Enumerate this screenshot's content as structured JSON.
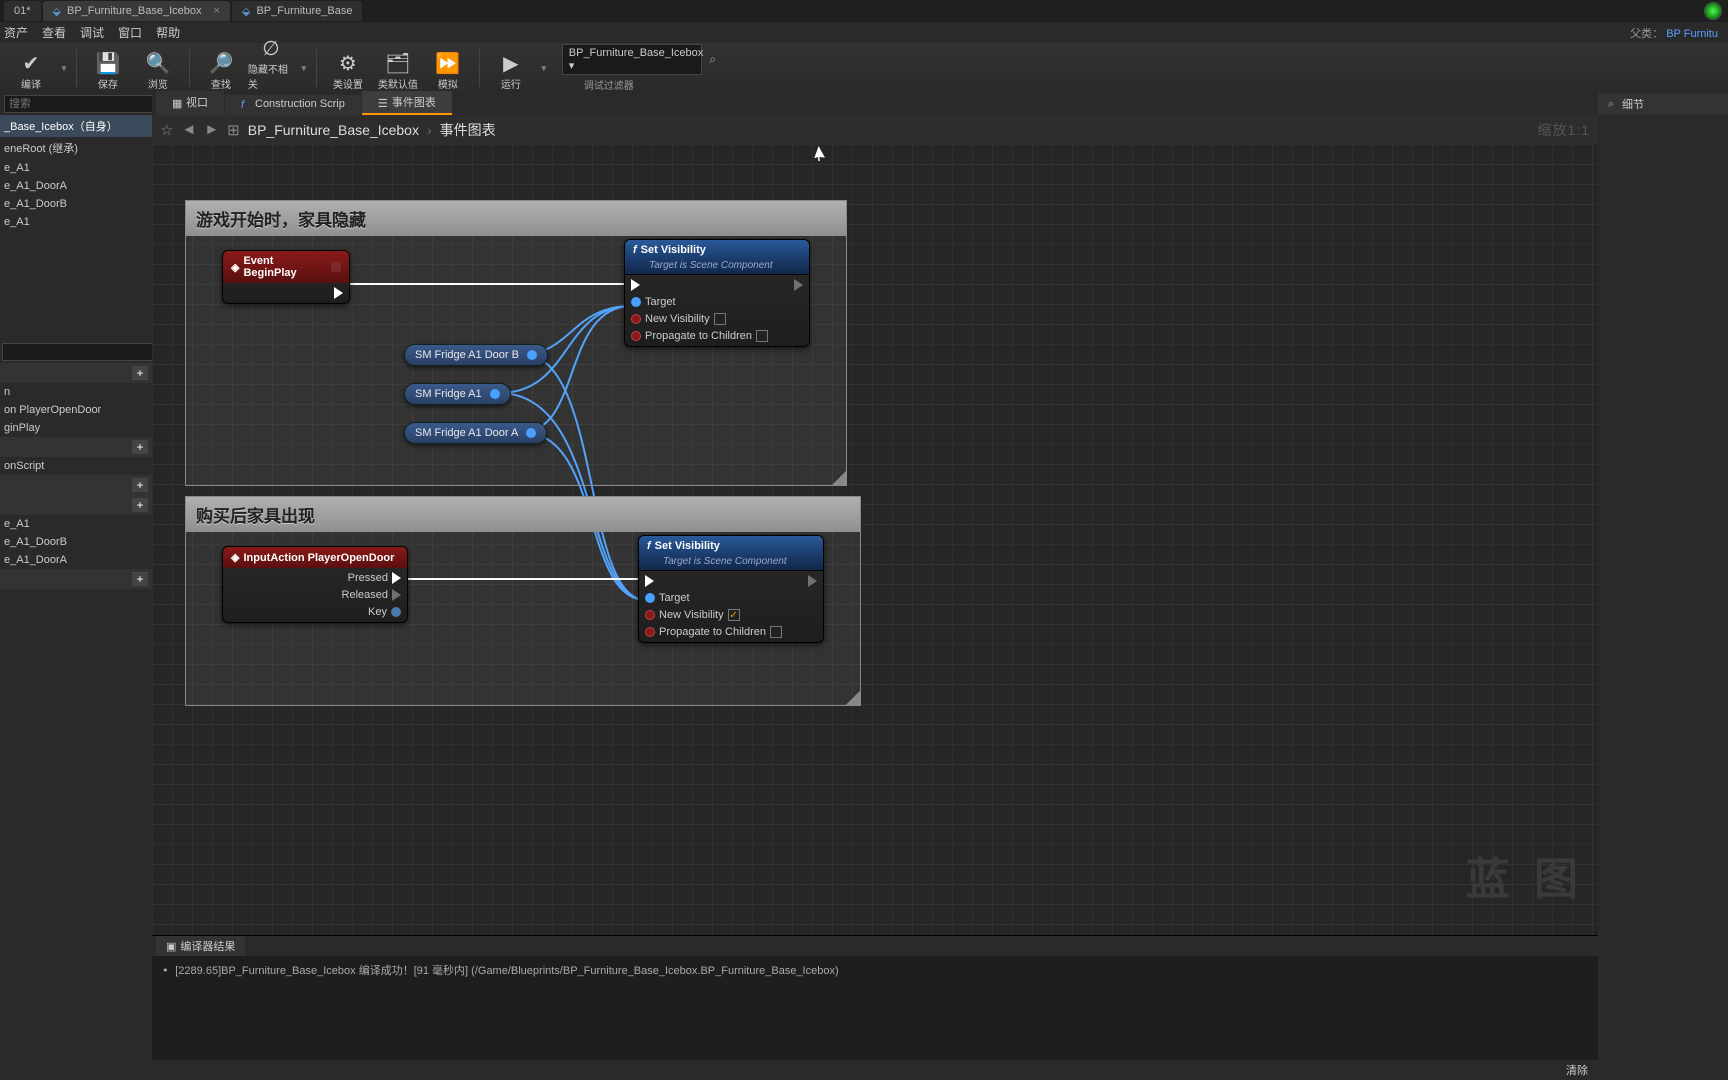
{
  "topTabs": {
    "t0": "01*",
    "t1": "BP_Furniture_Base_Icebox",
    "t2": "BP_Furniture_Base"
  },
  "menu": {
    "m0": "资产",
    "m1": "查看",
    "m2": "调试",
    "m3": "窗口",
    "m4": "帮助",
    "parentLabel": "父类：",
    "parentLink": "BP Furnitu"
  },
  "toolbar": {
    "compile": "编译",
    "save": "保存",
    "browse": "浏览",
    "find": "查找",
    "hideUnrelated": "隐藏不相关",
    "classSettings": "类设置",
    "classDefaults": "类默认值",
    "simulate": "模拟",
    "play": "运行",
    "debugObject": "BP_Furniture_Base_Icebox",
    "debugFilter": "调试过滤器"
  },
  "leftPanel": {
    "searchPlaceholder": "搜索",
    "compSelf": "_Base_Icebox（自身）",
    "compRoot": "eneRoot (继承)",
    "compA1": "e_A1",
    "compDoorA": "e_A1_DoorA",
    "compDoorB": "e_A1_DoorB",
    "graphItem0": "n",
    "graphItem1": "on PlayerOpenDoor",
    "graphItem2": "ginPlay",
    "graphItem3": "onScript",
    "varA1": "e_A1",
    "varDoorB": "e_A1_DoorB",
    "varDoorA": "e_A1_DoorA"
  },
  "centerTabs": {
    "viewport": "视口",
    "construction": "Construction Scrip",
    "eventGraph": "事件图表"
  },
  "breadcrumb": {
    "bp": "BP_Furniture_Base_Icebox",
    "graph": "事件图表",
    "zoom": "缩放1:1"
  },
  "graph": {
    "comment1": "游戏开始时，家具隐藏",
    "comment2": "购买后家具出现",
    "watermark": "蓝 图",
    "nodes": {
      "beginPlay": "Event BeginPlay",
      "setVis": "Set Visibility",
      "setVisSub": "Target is Scene Component",
      "target": "Target",
      "newVis": "New Visibility",
      "propagate": "Propagate to Children",
      "inputAction": "InputAction PlayerOpenDoor",
      "pressed": "Pressed",
      "released": "Released",
      "key": "Key",
      "varDoorB": "SM Fridge A1 Door B",
      "varA1": "SM Fridge A1",
      "varDoorA": "SM Fridge A1 Door A"
    }
  },
  "compiler": {
    "tab": "编译器结果",
    "line": "[2289.65]BP_Furniture_Base_Icebox 编译成功！[91 毫秒内] (/Game/Blueprints/BP_Furniture_Base_Icebox.BP_Furniture_Base_Icebox)",
    "clear": "清除"
  },
  "rightPanel": {
    "details": "细节"
  }
}
